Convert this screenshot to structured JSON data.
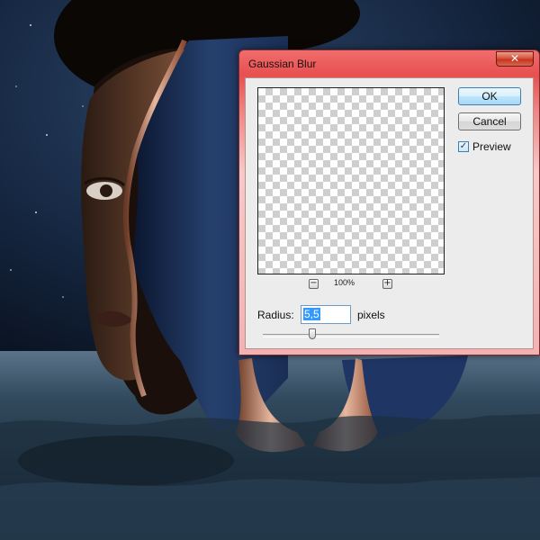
{
  "dialog": {
    "title": "Gaussian Blur",
    "close_glyph": "✕",
    "ok_label": "OK",
    "cancel_label": "Cancel",
    "preview_label": "Preview",
    "preview_checked": true,
    "check_glyph": "✓",
    "zoom_out_glyph": "−",
    "zoom_in_glyph": "+",
    "zoom_level": "100%",
    "radius_label": "Radius:",
    "radius_value": "5,5",
    "radius_unit": "pixels",
    "radius_slider_fraction": 0.28
  },
  "colors": {
    "titlebar_accent": "#e7504f",
    "close_button": "#c8341f",
    "focus_blue": "#3399ff"
  },
  "icons": [
    "close-icon",
    "check-icon",
    "zoom-out-icon",
    "zoom-in-icon"
  ]
}
